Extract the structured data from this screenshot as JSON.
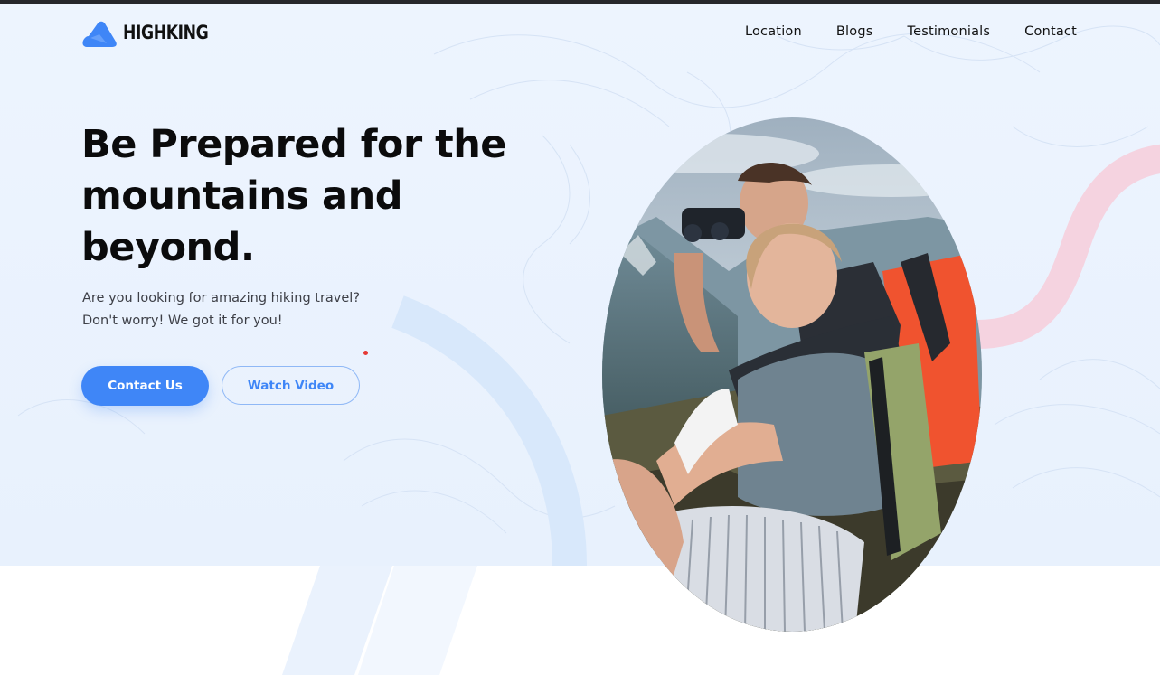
{
  "brand": {
    "name": "HIGHKING",
    "accent_color": "#3f86f7",
    "logo_icon": "mountain-logo-icon"
  },
  "nav": {
    "items": [
      {
        "label": "Location"
      },
      {
        "label": "Blogs"
      },
      {
        "label": "Testimonials"
      },
      {
        "label": "Contact"
      }
    ]
  },
  "hero": {
    "title_lines": [
      "Be Prepared for the",
      "mountains and",
      "beyond."
    ],
    "subtitle_lines": [
      "Are you looking for amazing hiking travel?",
      "Don't worry! We got it for you!"
    ],
    "primary_button": "Contact Us",
    "secondary_button": "Watch Video"
  }
}
